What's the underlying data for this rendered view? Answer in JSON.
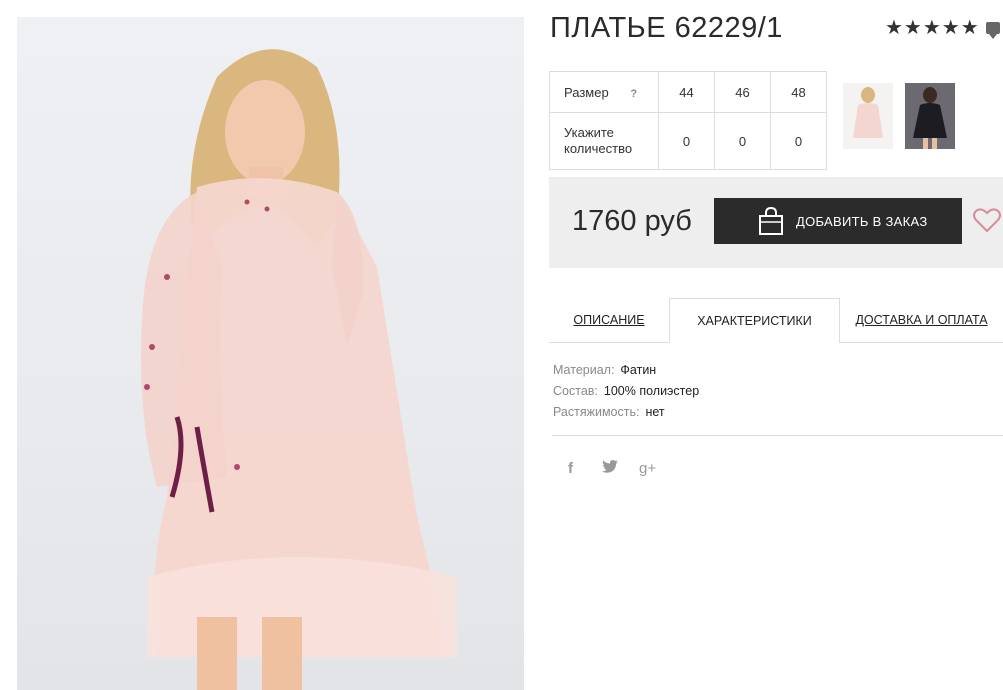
{
  "product": {
    "title": "ПЛАТЬЕ 62229/1",
    "rating_stars": "★★★★★",
    "price": "1760 руб",
    "order_button": "ДОБАВИТЬ В ЗАКАЗ",
    "sizes_label": "Размер",
    "help_mark": "?",
    "quantity_label": "Укажите количество",
    "sizes": [
      "44",
      "46",
      "48"
    ],
    "quantities": [
      "0",
      "0",
      "0"
    ]
  },
  "tabs": [
    "ОПИСАНИЕ",
    "ХАРАКТЕРИСТИКИ",
    "ДОСТАВКА И ОПЛАТА"
  ],
  "specs": [
    {
      "key": "Материал:",
      "value": "Фатин"
    },
    {
      "key": "Состав:",
      "value": "100% полиэстер"
    },
    {
      "key": "Растяжимость:",
      "value": "нет"
    }
  ],
  "social": {
    "facebook": "f",
    "twitter": "t",
    "googleplus": "g+"
  },
  "icons": [
    "star-icon",
    "comment-icon",
    "shopping-bag-icon",
    "heart-icon",
    "facebook-icon",
    "twitter-icon",
    "google-plus-icon"
  ],
  "colors": {
    "button_bg": "#2b2b2b",
    "price_box_bg": "#eeeeee",
    "heart": "#d98a99"
  }
}
